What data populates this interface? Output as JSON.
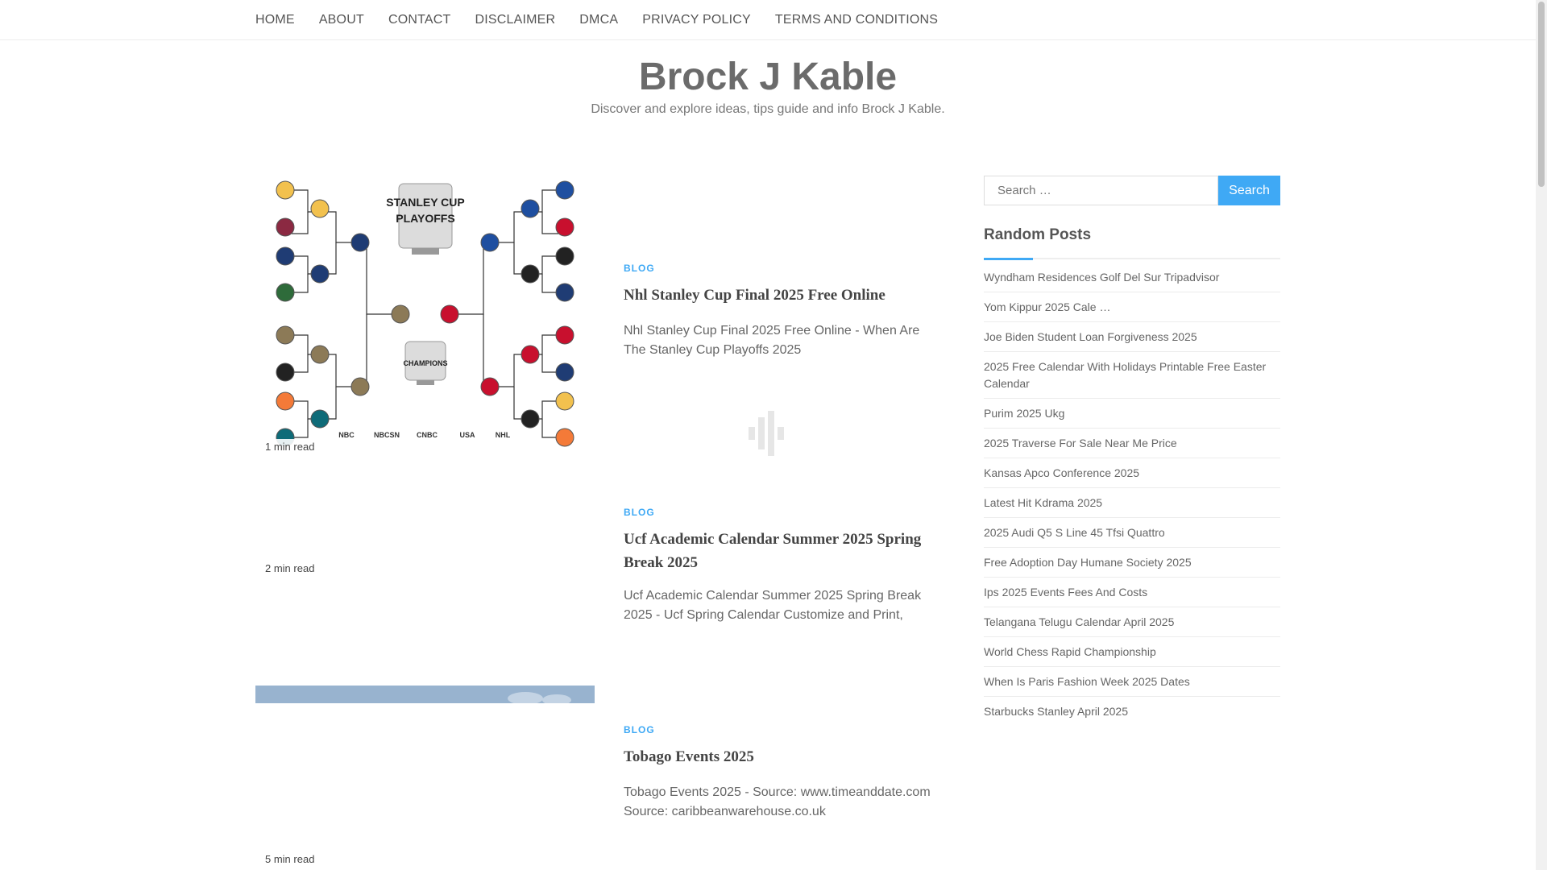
{
  "nav": {
    "items": [
      "HOME",
      "ABOUT",
      "CONTACT",
      "DISCLAIMER",
      "DMCA",
      "PRIVACY POLICY",
      "TERMS AND CONDITIONS"
    ]
  },
  "header": {
    "title": "Brock J Kable",
    "description": "Discover and explore ideas, tips guide and info Brock J Kable."
  },
  "posts": [
    {
      "read_time": "1 min read",
      "category": "BLOG",
      "title": "Nhl Stanley Cup Final 2025 Free Online",
      "excerpt": "Nhl Stanley Cup Final 2025 Free Online - When Are The Stanley Cup Playoffs 2025",
      "image": {
        "headline": "STANLEY CUP",
        "subheadline": "PLAYOFFS",
        "champions": "CHAMPIONS",
        "broadcasters": [
          "NBC",
          "NBCSN",
          "CNBC",
          "USA",
          "NHL"
        ]
      }
    },
    {
      "read_time": "2 min read",
      "category": "BLOG",
      "title": "Ucf Academic Calendar Summer 2025 Spring Break 2025",
      "excerpt": "Ucf Academic Calendar Summer 2025 Spring Break 2025 - Ucf Spring Calendar Customize and Print,"
    },
    {
      "read_time": "5 min read",
      "category": "BLOG",
      "title": "Tobago Events 2025",
      "excerpt": "Tobago Events 2025 - Source: www.timeanddate.com Source: caribbeanwarehouse.co.uk"
    }
  ],
  "sidebar": {
    "search_placeholder": "Search …",
    "search_button": "Search",
    "widget_title": "Random Posts",
    "random_posts": [
      "Wyndham Residences Golf Del Sur Tripadvisor",
      "Yom Kippur 2025 Cale …",
      "Joe Biden Student Loan Forgiveness 2025",
      "2025 Free Calendar With Holidays Printable Free Easter Calendar",
      "Purim 2025 Ukg",
      "2025 Traverse For Sale Near Me Price",
      "Kansas Apco Conference 2025",
      "Latest Hit Kdrama 2025",
      "2025 Audi Q5 S Line 45 Tfsi Quattro",
      "Free Adoption Day Humane Society 2025",
      "Ips 2025 Events Fees And Costs",
      "Telangana Telugu Calendar April 2025",
      "World Chess Rapid Championship",
      "When Is Paris Fashion Week 2025 Dates",
      "Starbucks Stanley April 2025"
    ]
  },
  "colors": {
    "accent": "#3fa9f5",
    "text": "#555555",
    "title": "#6b6b6b"
  }
}
